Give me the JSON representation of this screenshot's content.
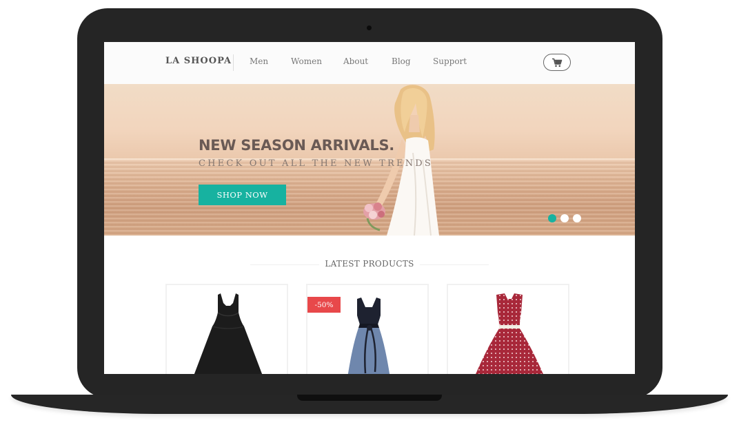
{
  "nav": {
    "brand": "LA SHOOPA",
    "items": [
      "Men",
      "Women",
      "About",
      "Blog",
      "Support"
    ]
  },
  "hero": {
    "title": "NEW SEASON ARRIVALS.",
    "subtitle": "CHECK OUT ALL THE NEW TRENDS",
    "button_label": "SHOP NOW",
    "slides": 3,
    "active_slide": 1
  },
  "products": {
    "section_title": "LATEST PRODUCTS",
    "items": [
      {
        "dress_icon": "black-dress-icon",
        "badge": ""
      },
      {
        "dress_icon": "blue-dress-icon",
        "badge": "-50%"
      },
      {
        "dress_icon": "red-polka-dress-icon",
        "badge": ""
      }
    ]
  },
  "colors": {
    "accent": "#17b2a0",
    "sale_badge": "#e8484a",
    "frame": "#252525"
  }
}
